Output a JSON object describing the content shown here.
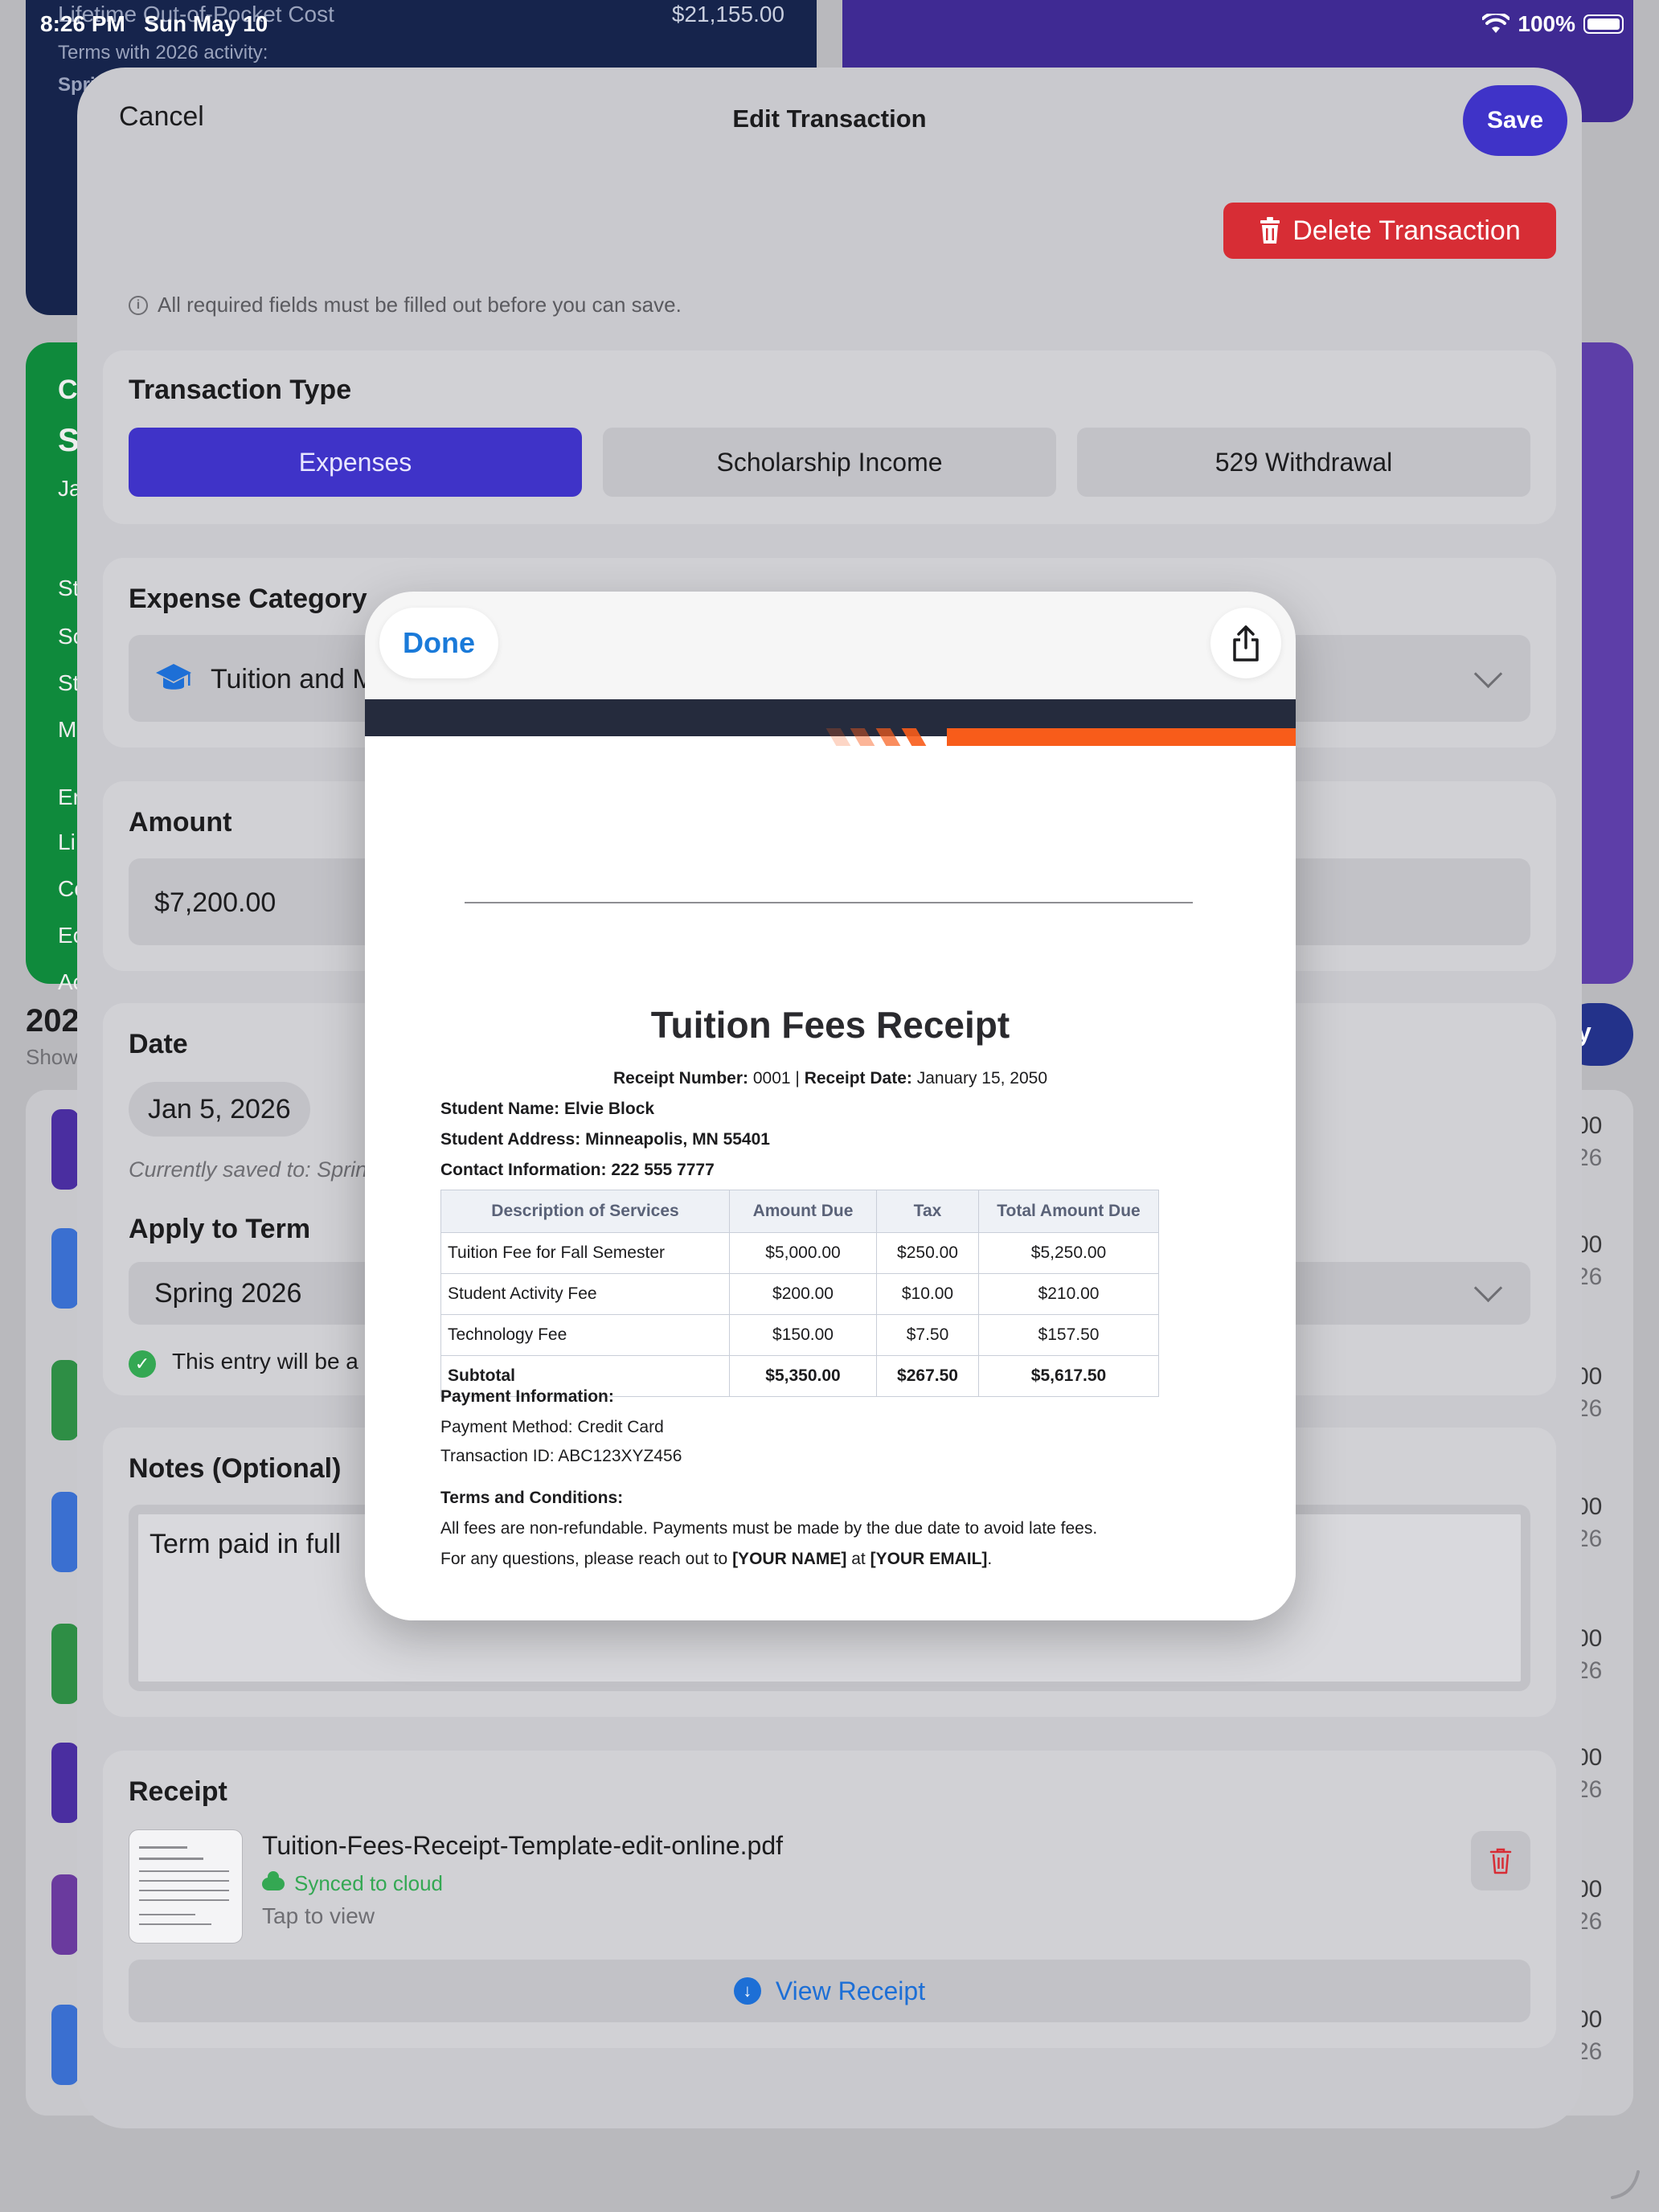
{
  "status_bar": {
    "time": "8:26 PM",
    "date": "Sun May 10",
    "battery": "100%"
  },
  "background": {
    "top_card_label": "Lifetime Out-of-Pocket Cost",
    "top_card_value": "$21,155.00",
    "top_card_sub": "Terms with 2026 activity:",
    "top_card_term": "Spri",
    "green_card_letters": [
      "C",
      "S",
      "Ja",
      "St",
      "Sc",
      "St",
      "M",
      "Er",
      "Li",
      "Co",
      "Ec",
      "Ac"
    ],
    "year_label": "202",
    "show_label": "Show",
    "row_values": [
      "00",
      "00",
      "00",
      "00",
      "00",
      "00",
      "00",
      "00"
    ],
    "row_years": [
      "26",
      "26",
      "26",
      "26",
      "26",
      "26",
      "26",
      "26"
    ],
    "pill_letter": "y"
  },
  "sheet": {
    "cancel": "Cancel",
    "title": "Edit Transaction",
    "save": "Save",
    "delete": "Delete Transaction",
    "info_note": "All required fields must be filled out before you can save."
  },
  "transaction_type": {
    "title": "Transaction Type",
    "options": [
      "Expenses",
      "Scholarship Income",
      "529 Withdrawal"
    ],
    "selected": "Expenses"
  },
  "expense_category": {
    "title": "Expense Category",
    "value": "Tuition and M"
  },
  "amount": {
    "title": "Amount",
    "value": "$7,200.00"
  },
  "date": {
    "title": "Date",
    "value": "Jan 5, 2026",
    "saved_note": "Currently saved to: Sprin",
    "apply_title": "Apply to Term",
    "term": "Spring 2026",
    "entry_note": "This entry will be a"
  },
  "notes": {
    "title": "Notes (Optional)",
    "value": "Term paid in full"
  },
  "receipt": {
    "title": "Receipt",
    "file_name": "Tuition-Fees-Receipt-Template-edit-online.pdf",
    "synced": "Synced to cloud",
    "tap": "Tap to view",
    "view_button": "View Receipt"
  },
  "preview": {
    "done": "Done",
    "doc": {
      "title": "Tuition Fees Receipt",
      "receipt_number_label": "Receipt Number:",
      "receipt_number": "0001",
      "receipt_date_label": "Receipt Date:",
      "receipt_date": "January 15, 2050",
      "student_name": "Student Name: Elvie Block",
      "student_address": "Student Address: Minneapolis, MN 55401",
      "contact": "Contact Information: 222 555 7777",
      "table_headers": [
        "Description of Services",
        "Amount Due",
        "Tax",
        "Total Amount Due"
      ],
      "rows": [
        [
          "Tuition Fee for Fall Semester",
          "$5,000.00",
          "$250.00",
          "$5,250.00"
        ],
        [
          "Student Activity Fee",
          "$200.00",
          "$10.00",
          "$210.00"
        ],
        [
          "Technology Fee",
          "$150.00",
          "$7.50",
          "$157.50"
        ]
      ],
      "subtotal": [
        "Subtotal",
        "$5,350.00",
        "$267.50",
        "$5,617.50"
      ],
      "payment_info_title": "Payment Information:",
      "payment_method": "Payment Method: Credit Card",
      "transaction_id": "Transaction ID: ABC123XYZ456",
      "terms_title": "Terms and Conditions:",
      "terms_text": "All fees are non-refundable. Payments must be made by the due date to avoid late fees.",
      "questions_prefix": "For any questions, please reach out to",
      "your_name": "[YOUR NAME]",
      "at": "at",
      "your_email": "[YOUR EMAIL]",
      "period": "."
    }
  },
  "colors": {
    "accent": "#3f33c8",
    "delete": "#d72d35",
    "link": "#1a7ad9",
    "success": "#34a853",
    "doc_orange": "#f85c1a",
    "doc_navy": "#252b3d"
  }
}
